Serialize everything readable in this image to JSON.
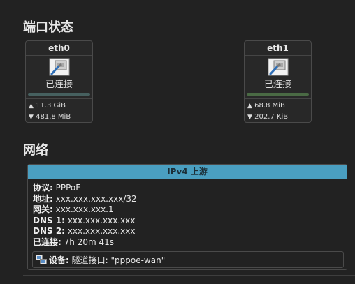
{
  "ports_section": {
    "title": "端口状态"
  },
  "ports": [
    {
      "name": "eth0",
      "status": "已连接",
      "status_color": "#46605f",
      "tx": "11.3 GiB",
      "rx": "481.8 MiB"
    },
    {
      "name": "eth1",
      "status": "已连接",
      "status_color": "#4a6a44",
      "tx": "68.8 MiB",
      "rx": "202.7 KiB"
    }
  ],
  "network_section": {
    "title": "网络",
    "header": "IPv4 上游",
    "rows": [
      {
        "label": "协议:",
        "value": "PPPoE"
      },
      {
        "label": "地址:",
        "value": "xxx.xxx.xxx.xxx/32"
      },
      {
        "label": "网关:",
        "value": "xxx.xxx.xxx.1"
      },
      {
        "label": "DNS 1:",
        "value": "xxx.xxx.xxx.xxx"
      },
      {
        "label": "DNS 2:",
        "value": "xxx.xxx.xxx.xxx"
      },
      {
        "label": "已连接:",
        "value": "7h 20m 41s"
      }
    ],
    "device": {
      "label": "设备:",
      "value": "隧道接口: \"pppoe-wan\""
    }
  },
  "icons": {
    "port": "ethernet-port-icon",
    "device": "network-device-icon"
  },
  "colors": {
    "header_bg": "#4a9fc1"
  }
}
